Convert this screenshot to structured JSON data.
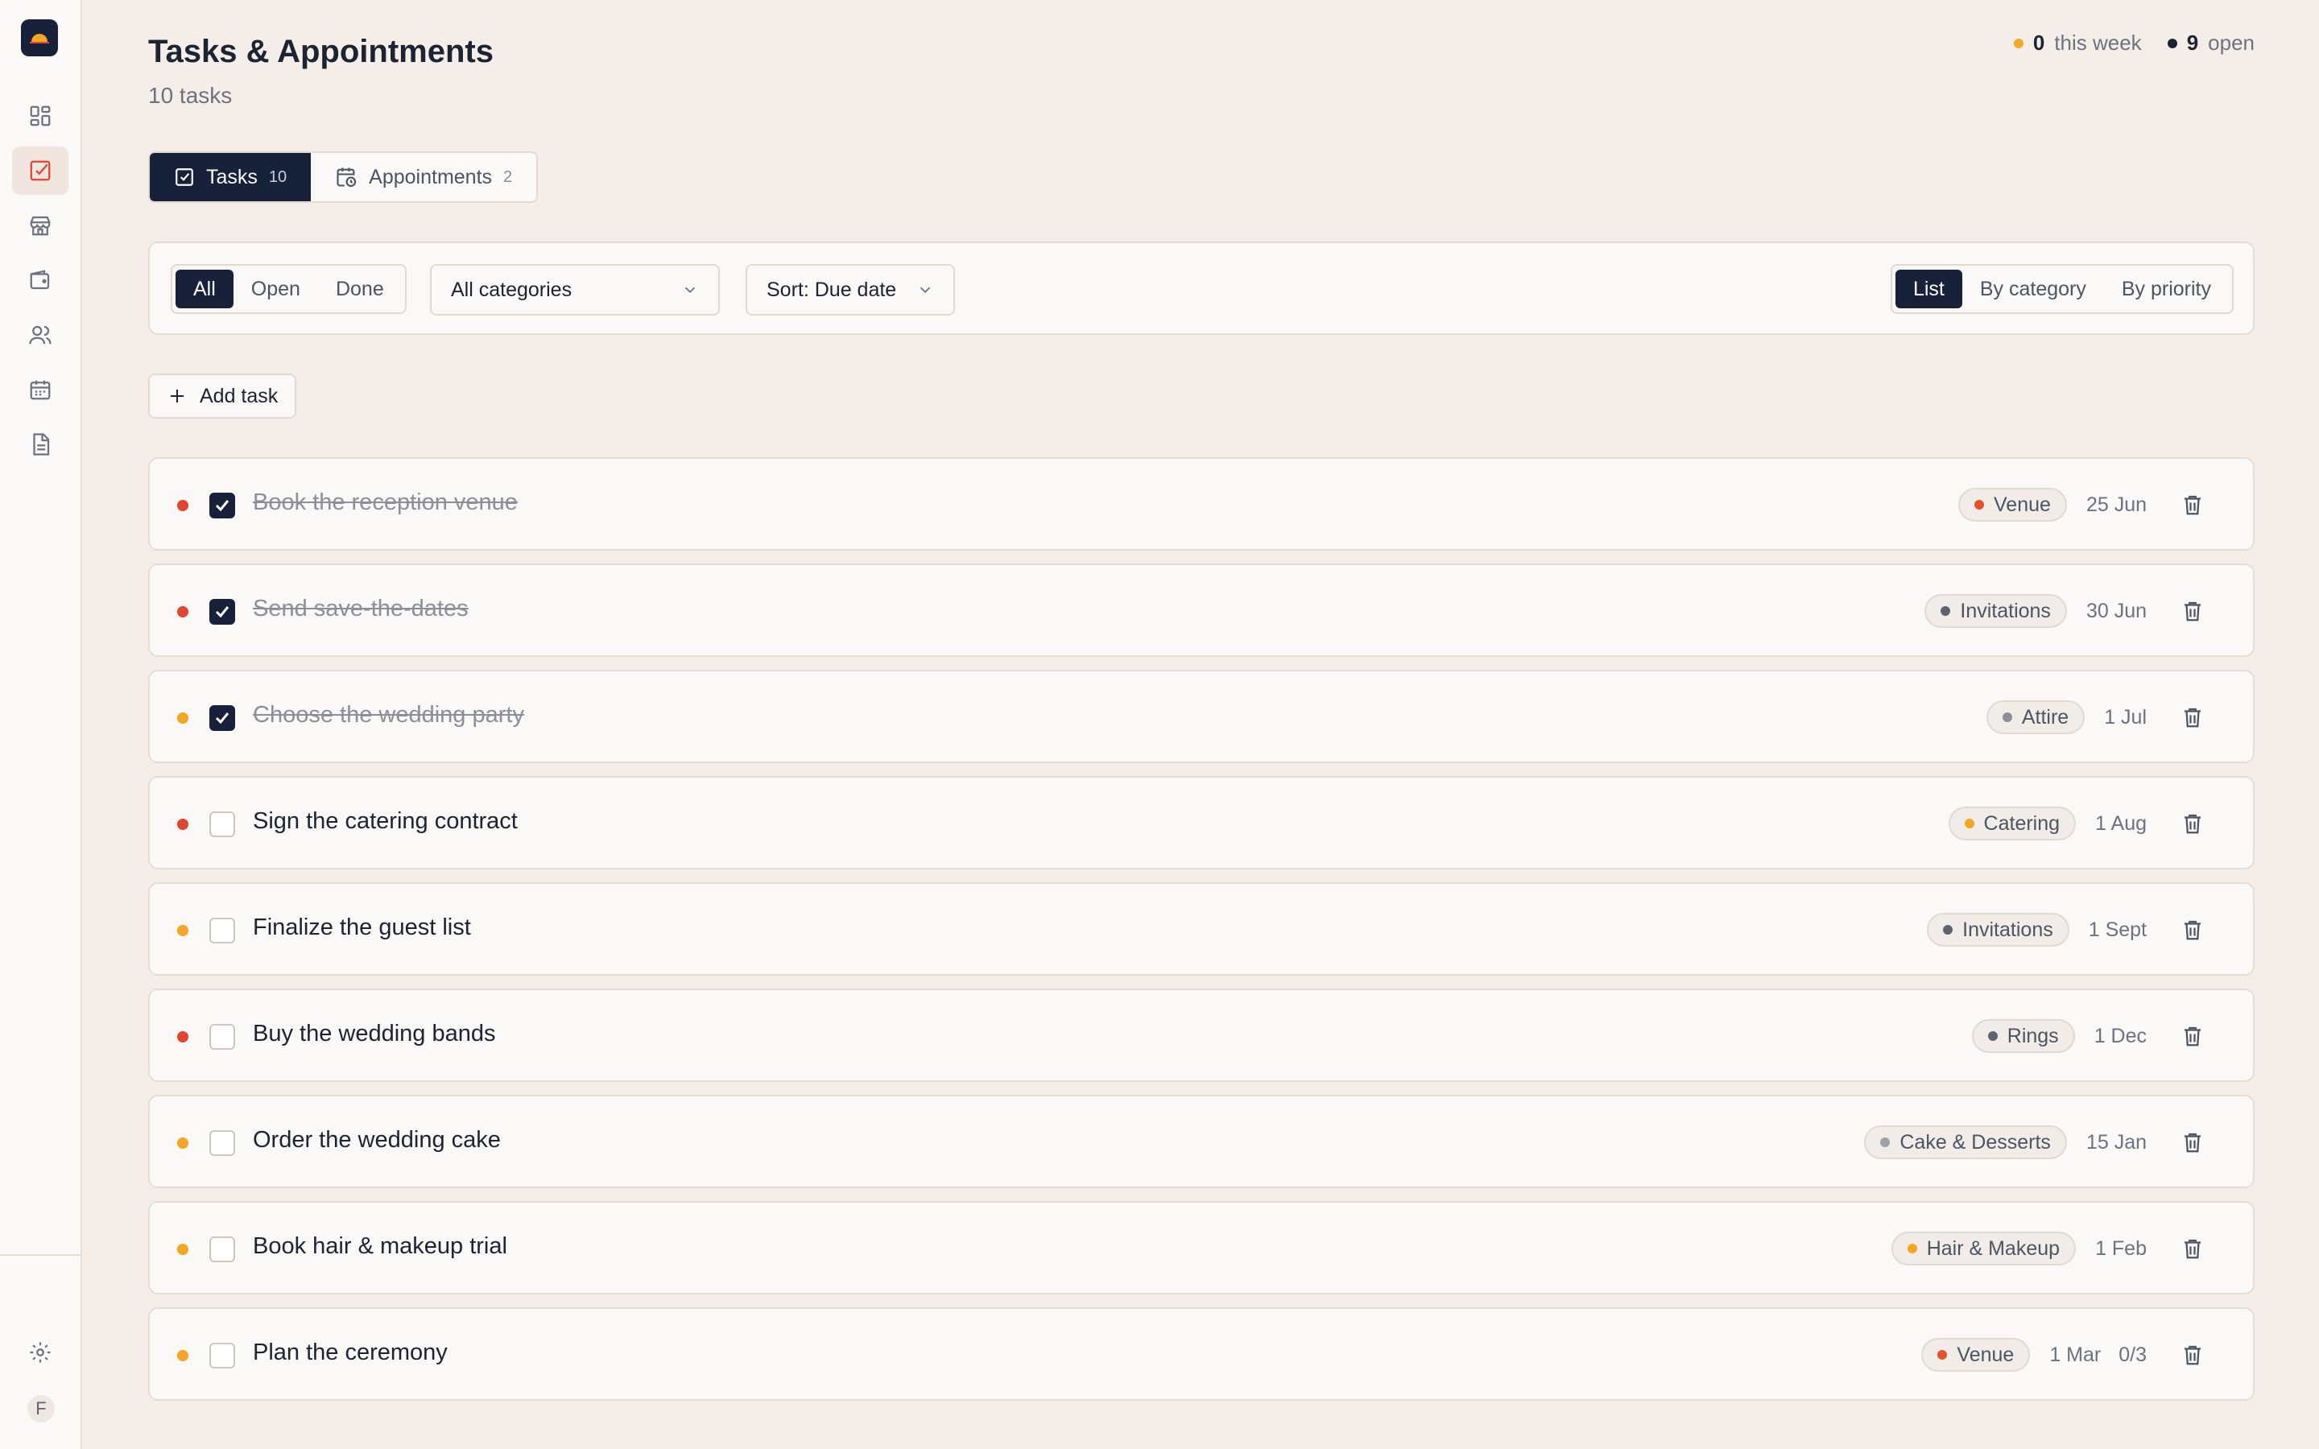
{
  "header": {
    "title": "Tasks & Appointments",
    "subtitle": "10 tasks"
  },
  "stats": [
    {
      "value": "0",
      "label": "this week",
      "color": "#f5a623"
    },
    {
      "value": "9",
      "label": "open",
      "color": "#1c2434"
    }
  ],
  "tabs": [
    {
      "label": "Tasks",
      "count": "10",
      "icon": "check-square-icon",
      "active": true
    },
    {
      "label": "Appointments",
      "count": "2",
      "icon": "calendar-clock-icon",
      "active": false
    }
  ],
  "filters": {
    "status": [
      "All",
      "Open",
      "Done"
    ],
    "status_selected": "All",
    "category_select": "All categories",
    "sort_select": "Sort: Due date",
    "views": [
      "List",
      "By category",
      "By priority"
    ],
    "view_selected": "List"
  },
  "add_task_label": "Add task",
  "tasks": [
    {
      "title": "Book the reception venue",
      "done": true,
      "priority": "high",
      "category": "Venue",
      "category_color": "#e8502b",
      "due": "25 Jun",
      "extra": ""
    },
    {
      "title": "Send save-the-dates",
      "done": true,
      "priority": "high",
      "category": "Invitations",
      "category_color": "#5c6473",
      "due": "30 Jun",
      "extra": ""
    },
    {
      "title": "Choose the wedding party",
      "done": true,
      "priority": "medium",
      "category": "Attire",
      "category_color": "#8a8f99",
      "due": "1 Jul",
      "extra": ""
    },
    {
      "title": "Sign the catering contract",
      "done": false,
      "priority": "high",
      "category": "Catering",
      "category_color": "#f5a623",
      "due": "1 Aug",
      "extra": ""
    },
    {
      "title": "Finalize the guest list",
      "done": false,
      "priority": "medium",
      "category": "Invitations",
      "category_color": "#5c6473",
      "due": "1 Sept",
      "extra": ""
    },
    {
      "title": "Buy the wedding bands",
      "done": false,
      "priority": "high",
      "category": "Rings",
      "category_color": "#5c6473",
      "due": "1 Dec",
      "extra": ""
    },
    {
      "title": "Order the wedding cake",
      "done": false,
      "priority": "medium",
      "category": "Cake & Desserts",
      "category_color": "#9ca0a8",
      "due": "15 Jan",
      "extra": ""
    },
    {
      "title": "Book hair & makeup trial",
      "done": false,
      "priority": "medium",
      "category": "Hair & Makeup",
      "category_color": "#f5a623",
      "due": "1 Feb",
      "extra": ""
    },
    {
      "title": "Plan the ceremony",
      "done": false,
      "priority": "medium",
      "category": "Venue",
      "category_color": "#e8502b",
      "due": "1 Mar",
      "extra": "0/3"
    }
  ],
  "sidebar": {
    "items": [
      {
        "icon": "dashboard-icon",
        "active": false
      },
      {
        "icon": "tasks-icon",
        "active": true
      },
      {
        "icon": "vendors-store-icon",
        "active": false
      },
      {
        "icon": "wallet-icon",
        "active": false
      },
      {
        "icon": "guests-users-icon",
        "active": false
      },
      {
        "icon": "calendar-icon",
        "active": false
      },
      {
        "icon": "document-icon",
        "active": false
      }
    ],
    "settings_icon": "gear-icon",
    "avatar_initial": "F"
  },
  "colors": {
    "priority_high": "#e5432f",
    "priority_medium": "#f5a623",
    "accent": "#17213a"
  }
}
